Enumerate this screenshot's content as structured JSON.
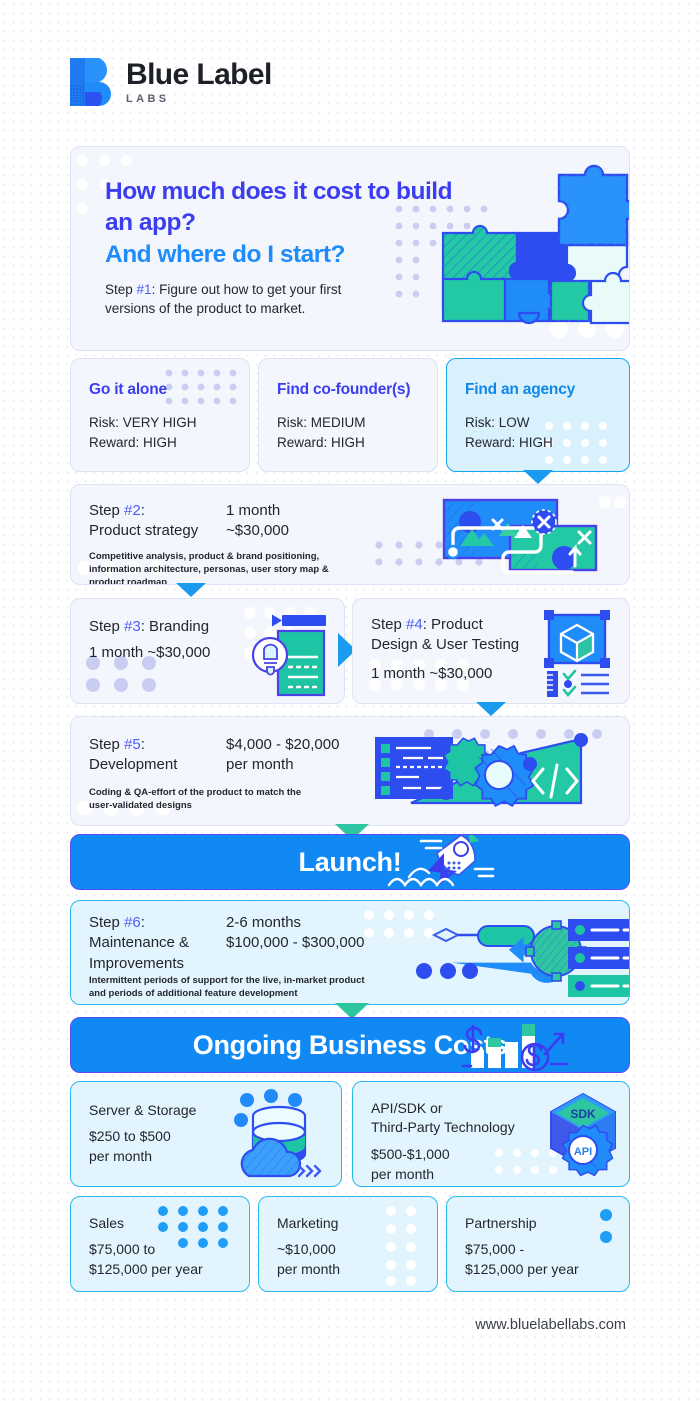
{
  "brand": {
    "name": "Blue Label",
    "sub": "LABS",
    "logo_icon": "blue-label-b-mark",
    "footer_url": "www.bluelabellabs.com",
    "colors": {
      "indigo": "#3b3ef0",
      "azure": "#1f8cf9",
      "banner_blue": "#1089f5",
      "teal": "#22c9a4",
      "card_bg": "#f3f6fc",
      "cyan_card_bg": "#e2f5fe",
      "cyan_border": "#2bb8f2"
    }
  },
  "hero": {
    "title_line1": "How much does it cost to build an app?",
    "title_line2": "And where do I start?",
    "step_label": "Step",
    "step_number": "#1",
    "step_text": ": Figure out how to get your first versions of the product to market.",
    "illustration": "puzzle-pieces"
  },
  "options": [
    {
      "title": "Go it alone",
      "risk": "Risk: VERY HIGH",
      "reward": "Reward: HIGH",
      "highlighted": false
    },
    {
      "title": "Find co-founder(s)",
      "risk": "Risk: MEDIUM",
      "reward": "Reward: HIGH",
      "highlighted": false
    },
    {
      "title": "Find an agency",
      "risk": "Risk: LOW",
      "reward": "Reward: HIGH",
      "highlighted": true
    }
  ],
  "steps": {
    "step2": {
      "label": "Step",
      "number": "#2",
      "colon": ":",
      "name": "Product strategy",
      "duration": "1 month",
      "cost": "~$30,000",
      "description": "Competitive analysis, product & brand positioning, information architecture, personas, user story map & product roadmap",
      "illustration": "strategy-roadmap"
    },
    "step3": {
      "label": "Step",
      "number": "#3",
      "name": ": Branding",
      "cost_line": "1 month ~$30,000",
      "illustration": "branding-lightbulb-document"
    },
    "step4": {
      "label": "Step",
      "number": "#4",
      "name": ": Product",
      "name2": "Design & User Testing",
      "cost_line": "1 month ~$30,000",
      "illustration": "design-cube-checklist"
    },
    "step5": {
      "label": "Step",
      "number": "#5",
      "colon": ":",
      "name": "Development",
      "cost": "$4,000 - $20,000",
      "cost_period": "per month",
      "description": "Coding & QA-effort of the product to match the user-validated designs",
      "illustration": "development-gears-code"
    },
    "step6": {
      "label": "Step",
      "number": "#6",
      "colon": ":",
      "name_line1": "Maintenance &",
      "name_line2": "Improvements",
      "duration": "2-6 months",
      "cost": "$100,000 - $300,000",
      "description": "Intermittent periods of support for the live, in-market product and periods of additional feature development",
      "illustration": "maintenance-wrench-servers"
    }
  },
  "launch_banner": {
    "text": "Launch!",
    "illustration": "rocket"
  },
  "ongoing_banner": {
    "text": "Ongoing Business Costs",
    "illustration": "bar-chart-dollar"
  },
  "ongoing_costs_row1": [
    {
      "title": "Server & Storage",
      "value_line1": "$250 to $500",
      "value_line2": "per month",
      "illustration": "database-cloud"
    },
    {
      "title": "API/SDK or",
      "title_line2": "Third-Party Technology",
      "value_line1": "$500-$1,000",
      "value_line2": "per month",
      "illustration": "api-sdk-cube-gear"
    }
  ],
  "ongoing_costs_row2": [
    {
      "title": "Sales",
      "value_line1": "$75,000 to",
      "value_line2": "$125,000 per year"
    },
    {
      "title": "Marketing",
      "value_line1": "~$10,000",
      "value_line2": "per month"
    },
    {
      "title": "Partnership",
      "value_line1": "$75,000 -",
      "value_line2": "$125,000 per year"
    }
  ]
}
